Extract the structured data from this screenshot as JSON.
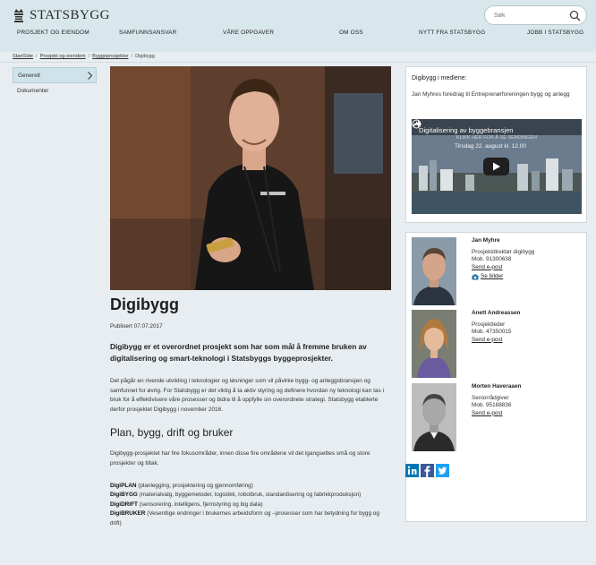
{
  "header": {
    "logo_text": "STATSBYGG",
    "search_placeholder": "Søk",
    "nav": [
      "PROSJEKT OG EIENDOM",
      "SAMFUNNSANSVAR",
      "VÅRE OPPGAVER",
      "OM OSS",
      "NYTT FRA STATSBYGG",
      "JOBB I STATSBYGG"
    ]
  },
  "breadcrumbs": [
    "StartSide",
    "Prosjekt og eiendom",
    "Byggeprosjekter",
    "Digibygg"
  ],
  "sidebar": {
    "items": [
      "Generelt",
      "Dokumenter"
    ]
  },
  "article": {
    "title": "Digibygg",
    "published": "Publisert 07.07.2017",
    "lead": "Digibygg er et overordnet prosjekt som har som mål å fremme bruken av digitalisering og smart-teknologi i Statsbyggs byggeprosjekter.",
    "paragraph1": "Det pågår en rivende utvikling i teknologier og løsninger som vil påvirke bygg- og anleggsbransjen og samfunnet for øvrig. For Statsbygg er det viktig å ta aktiv styring og definere hvordan ny teknologi kan tas i bruk for å effektivisere våre prosesser og bidra til å oppfylle sin overordnete strategi. Statsbygg etablerte derfor prosjektet Digibygg i november 2016.",
    "subheading": "Plan, bygg, drift og bruker",
    "paragraph2": "Digibygg-prosjektet har fire fokusområder, innen disse fire områdene vil det igangsettes små og store prosjekter og tiltak.",
    "focus_areas": [
      {
        "term": "DigiPLAN",
        "desc": "(planlegging, prosjektering og gjennomføring)"
      },
      {
        "term": "DigiBYGG",
        "desc": "(materialvalg, byggemetoder, logistikk, robotbruk, standardisering og fabrikkproduksjon)"
      },
      {
        "term": "DigiDRIFT",
        "desc": "(sensorering, intelligens, fjernstyring og big data)"
      },
      {
        "term": "DigiBRUKER",
        "desc": "(Vesentlige endringer i brukernes arbeidsform og –prosesser som har betydning for bygg og drift)"
      }
    ]
  },
  "media": {
    "heading": "Digibygg i medlene:",
    "description": "Jan Myhres foredrag til Entreprenørforeningen bygg og anlegg",
    "video_title": "Digitalisering av byggebransjen",
    "video_overlay": "KLIKK HER FOR Å SE SENDINGEN",
    "video_subtitle": "Tirsdag 22. august kl. 12.00"
  },
  "contacts": [
    {
      "name": "Jan Myhre",
      "role": "Prosjektdirektør digibygg",
      "phone": "Mob. 91300638",
      "email_link": "Send e-post",
      "images_link": "Se bilder"
    },
    {
      "name": "Anett Andreassen",
      "role": "Prosjektleder",
      "phone": "Mob. 47350015",
      "email_link": "Send e-post"
    },
    {
      "name": "Morten Haveraaen",
      "role": "Seniorrådgiver",
      "phone": "Mob. 95188836",
      "email_link": "Send e-post"
    }
  ],
  "social": [
    "linkedin-icon",
    "facebook-icon",
    "twitter-icon"
  ],
  "colors": {
    "header_bg": "#d8e7ec",
    "page_bg": "#e7edf0",
    "active_item_bg": "#cfe3ea",
    "linkedin": "#0077b5",
    "facebook": "#3b5998",
    "twitter": "#1da1f2"
  }
}
